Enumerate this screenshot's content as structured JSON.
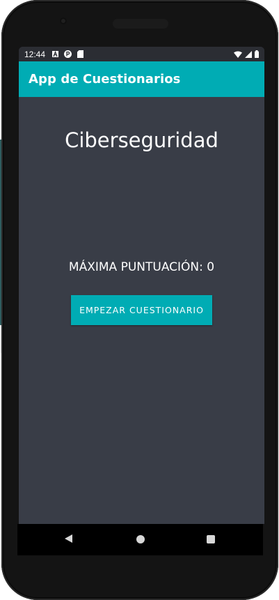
{
  "status_bar": {
    "time": "12:44",
    "icons_left": [
      "app-a-icon",
      "notification-p-icon",
      "sd-card-icon"
    ],
    "icons_right": [
      "wifi-icon",
      "signal-icon",
      "battery-icon"
    ]
  },
  "app_bar": {
    "title": "App de Cuestionarios"
  },
  "main": {
    "quiz_title": "Ciberseguridad",
    "max_score_text": "MÁXIMA PUNTUACIÓN: 0",
    "start_button_label": "EMPEZAR CUESTIONARIO"
  },
  "nav_bar": {
    "icons": [
      "back-icon",
      "home-icon",
      "recents-icon"
    ]
  },
  "colors": {
    "accent": "#00acb4",
    "screen_background": "#393d47",
    "status_bar": "#2b2d33",
    "text": "#ffffff"
  }
}
